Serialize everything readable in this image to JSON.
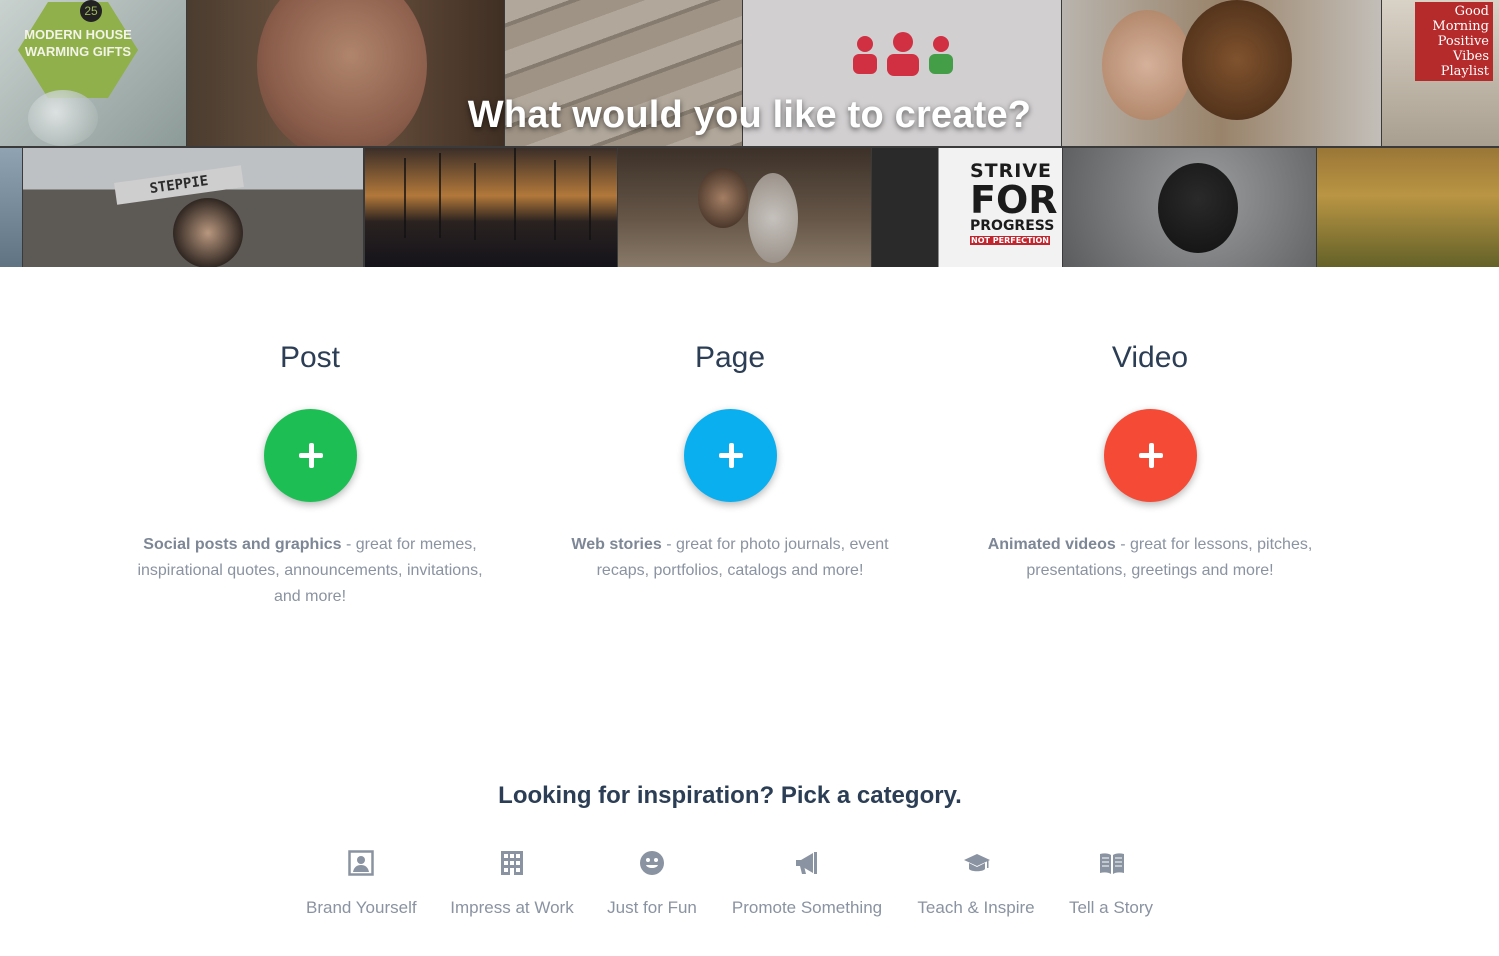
{
  "hero": {
    "title": "What would you like to create?",
    "tile_texts": {
      "gifts_number": "25",
      "gifts_line1": "MODERN HOUSE",
      "gifts_line2": "WARMING GIFTS",
      "playlist": [
        "Good",
        "Morning",
        "Positive",
        "Vibes",
        "Playlist"
      ],
      "steppie": "STEPPIE",
      "strive": "STRIVE",
      "for": "FOR",
      "progress": "PROGRESS",
      "not_perfection": "NOT PERFECTION"
    }
  },
  "options": [
    {
      "title": "Post",
      "color": "#1dbf55",
      "desc_bold": "Social posts and graphics",
      "desc_rest": " - great for memes, inspirational quotes, announcements, invitations, and more!"
    },
    {
      "title": "Page",
      "color": "#0aaff0",
      "desc_bold": "Web stories",
      "desc_rest": " - great for photo journals, event recaps, portfolios, catalogs and more!"
    },
    {
      "title": "Video",
      "color": "#f54a36",
      "desc_bold": "Animated videos",
      "desc_rest": " - great for lessons, pitches, presentations, greetings and more!"
    }
  ],
  "inspiration": {
    "title": "Looking for inspiration? Pick a category.",
    "categories": [
      {
        "label": "Brand Yourself",
        "icon": "portrait-icon"
      },
      {
        "label": "Impress at Work",
        "icon": "building-icon"
      },
      {
        "label": "Just for Fun",
        "icon": "smiley-icon"
      },
      {
        "label": "Promote Something",
        "icon": "megaphone-icon"
      },
      {
        "label": "Teach & Inspire",
        "icon": "graduation-cap-icon"
      },
      {
        "label": "Tell a Story",
        "icon": "book-icon"
      }
    ]
  },
  "colors": {
    "heading": "#2c3e55",
    "body_text": "#8a93a1",
    "icon": "#8a93a1"
  }
}
